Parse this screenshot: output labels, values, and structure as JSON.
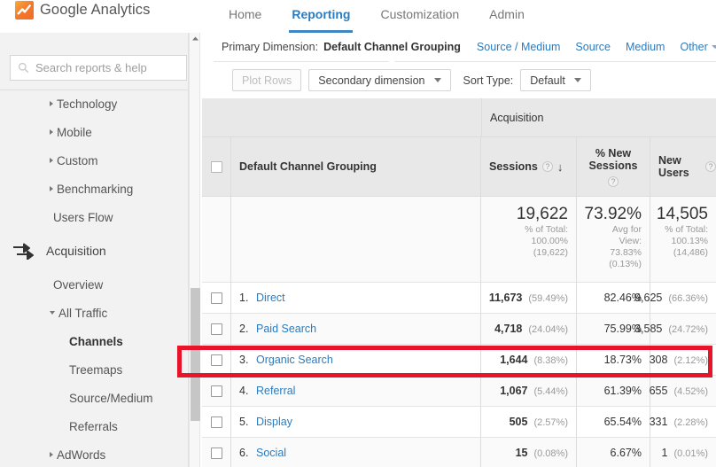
{
  "brand": {
    "name": "Google Analytics",
    "logo_icon": "analytics-logo-icon",
    "logo_color": "#f4762a"
  },
  "topnav": {
    "items": [
      {
        "label": "Home",
        "active": false
      },
      {
        "label": "Reporting",
        "active": true
      },
      {
        "label": "Customization",
        "active": false
      },
      {
        "label": "Admin",
        "active": false
      }
    ],
    "active_color": "#2c7bbd"
  },
  "sidebar": {
    "search": {
      "placeholder": "Search reports & help",
      "value": "",
      "icon": "search-icon"
    },
    "items": [
      {
        "label": "Technology",
        "level": 1,
        "caret": "right",
        "bold": false
      },
      {
        "label": "Mobile",
        "level": 1,
        "caret": "right",
        "bold": false
      },
      {
        "label": "Custom",
        "level": 1,
        "caret": "right",
        "bold": false
      },
      {
        "label": "Benchmarking",
        "level": 1,
        "caret": "right",
        "bold": false
      },
      {
        "label": "Users Flow",
        "level": 1,
        "caret": "none",
        "bold": false
      }
    ],
    "section": {
      "label": "Acquisition",
      "icon": "acquisition-arrows-icon"
    },
    "items2": [
      {
        "label": "Overview",
        "level": 1,
        "caret": "none",
        "bold": false
      },
      {
        "label": "All Traffic",
        "level": 1,
        "caret": "down",
        "bold": false
      },
      {
        "label": "Channels",
        "level": 2,
        "caret": "none",
        "bold": true
      },
      {
        "label": "Treemaps",
        "level": 2,
        "caret": "none",
        "bold": false
      },
      {
        "label": "Source/Medium",
        "level": 2,
        "caret": "none",
        "bold": false
      },
      {
        "label": "Referrals",
        "level": 2,
        "caret": "none",
        "bold": false
      },
      {
        "label": "AdWords",
        "level": 1,
        "caret": "right",
        "bold": false
      }
    ],
    "scrollbar": {
      "up_arrow_icon": "chevron-up-icon"
    },
    "collapse_icon": "chevron-left-icon"
  },
  "primary_dimension": {
    "label": "Primary Dimension:",
    "current": "Default Channel Grouping",
    "links": [
      "Source / Medium",
      "Source",
      "Medium"
    ],
    "other": "Other",
    "other_icon": "chevron-down-icon"
  },
  "toolbar": {
    "plot_rows": "Plot Rows",
    "secondary_dimension": "Secondary dimension",
    "secondary_dimension_icon": "chevron-down-icon",
    "sort_type_label": "Sort Type:",
    "sort_type_value": "Default",
    "sort_type_icon": "chevron-down-icon"
  },
  "table": {
    "group_header": "Acquisition",
    "dimension_header": "Default Channel Grouping",
    "metric_headers": [
      {
        "label": "Sessions",
        "help_icon": "help-icon",
        "sorted": true,
        "sort_icon": "arrow-down-icon"
      },
      {
        "label": "% New Sessions",
        "help_icon": "help-icon",
        "sorted": false,
        "sort_icon": ""
      },
      {
        "label": "New Users",
        "help_icon": "help-icon",
        "sorted": false,
        "sort_icon": ""
      }
    ],
    "summary": [
      {
        "value": "19,622",
        "lines": [
          "% of Total:",
          "100.00%",
          "(19,622)"
        ]
      },
      {
        "value": "73.92%",
        "lines": [
          "Avg for",
          "View:",
          "73.83%",
          "(0.13%)"
        ]
      },
      {
        "value": "14,505",
        "lines": [
          "% of Total:",
          "100.13%",
          "(14,486)"
        ]
      }
    ],
    "rows": [
      {
        "index": "1.",
        "name": "Direct",
        "sessions": "11,673",
        "sessions_pct": "(59.49%)",
        "new_sessions": "82.46%",
        "new_users": "9,625",
        "new_users_pct": "(66.36%)",
        "highlighted": false
      },
      {
        "index": "2.",
        "name": "Paid Search",
        "sessions": "4,718",
        "sessions_pct": "(24.04%)",
        "new_sessions": "75.99%",
        "new_users": "3,585",
        "new_users_pct": "(24.72%)",
        "highlighted": false
      },
      {
        "index": "3.",
        "name": "Organic Search",
        "sessions": "1,644",
        "sessions_pct": "(8.38%)",
        "new_sessions": "18.73%",
        "new_users": "308",
        "new_users_pct": "(2.12%)",
        "highlighted": true
      },
      {
        "index": "4.",
        "name": "Referral",
        "sessions": "1,067",
        "sessions_pct": "(5.44%)",
        "new_sessions": "61.39%",
        "new_users": "655",
        "new_users_pct": "(4.52%)",
        "highlighted": false
      },
      {
        "index": "5.",
        "name": "Display",
        "sessions": "505",
        "sessions_pct": "(2.57%)",
        "new_sessions": "65.54%",
        "new_users": "331",
        "new_users_pct": "(2.28%)",
        "highlighted": false
      },
      {
        "index": "6.",
        "name": "Social",
        "sessions": "15",
        "sessions_pct": "(0.08%)",
        "new_sessions": "6.67%",
        "new_users": "1",
        "new_users_pct": "(0.01%)",
        "highlighted": false
      }
    ]
  },
  "annotation": {
    "shape": "rectangle",
    "color": "#e8152a",
    "target_row": "Organic Search"
  }
}
